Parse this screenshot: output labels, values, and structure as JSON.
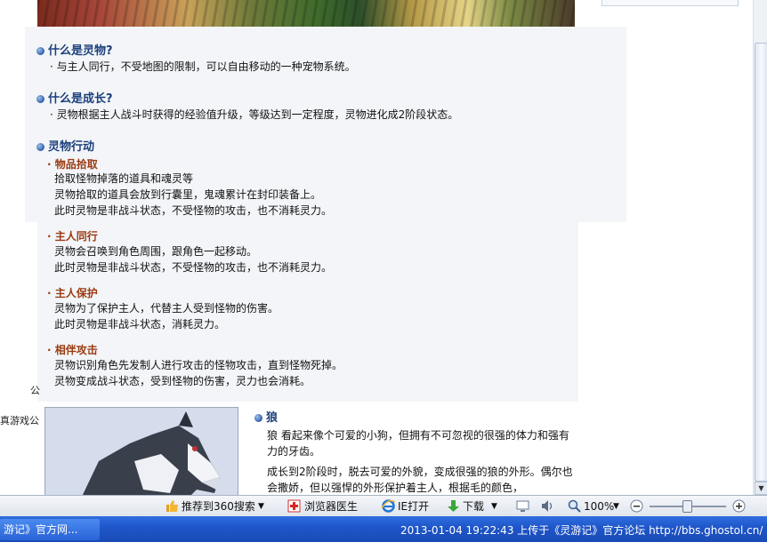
{
  "article": {
    "sections": [
      {
        "title": "什么是灵物?",
        "body": "· 与主人同行，不受地图的限制，可以自由移动的一种宠物系统。"
      },
      {
        "title": "什么是成长?",
        "body": "· 灵物根据主人战斗时获得的经验值升级，等级达到一定程度，灵物进化成2阶段状态。"
      }
    ],
    "actions_title": "灵物行动",
    "actions": [
      {
        "title": "· 物品拾取",
        "lines": [
          "拾取怪物掉落的道具和魂灵等",
          "灵物拾取的道具会放到行囊里，鬼魂累计在封印装备上。",
          "此时灵物是非战斗状态，不受怪物的攻击，也不消耗灵力。"
        ]
      },
      {
        "title": "· 主人同行",
        "lines": [
          "灵物会召唤到角色周围，跟角色一起移动。",
          "此时灵物是非战斗状态，不受怪物的攻击，也不消耗灵力。"
        ]
      },
      {
        "title": "· 主人保护",
        "lines": [
          "灵物为了保护主人，代替主人受到怪物的伤害。",
          "此时灵物是非战斗状态，消耗灵力。"
        ]
      },
      {
        "title": "· 相伴攻击",
        "lines": [
          "灵物识别角色先发制人进行攻击的怪物攻击，直到怪物死掉。",
          "灵物变成战斗状态，受到怪物的伤害，灵力也会消耗。"
        ]
      }
    ],
    "pet": {
      "name": "狼",
      "desc1": "狼  看起来像个可爱的小狗，但拥有不可忽视的很强的体力和强有力的牙齿。",
      "desc2": "成长到2阶段时，脱去可爱的外貌，变成很强的狼的外形。偶尔也会撒娇，但以强悍的外形保护着主人，根据毛的颜色，"
    }
  },
  "background_text": {
    "stray1": "公",
    "stray2": "真游戏公",
    "stray3": "游记》官方网..."
  },
  "statusbar": {
    "recommend": "推荐到360搜索",
    "doctor": "浏览器医生",
    "ie_open": "IE打开",
    "download": "下载",
    "zoom": "100%"
  },
  "taskbar": {
    "ticker": "2013-01-04 19:22:43 上传于《灵游记》官方论坛 http://bbs.ghostol.cn/"
  },
  "colors": {
    "heading": "#1a3f7a",
    "subheading": "#9a3b12",
    "taskbar": "#1e55c8"
  }
}
